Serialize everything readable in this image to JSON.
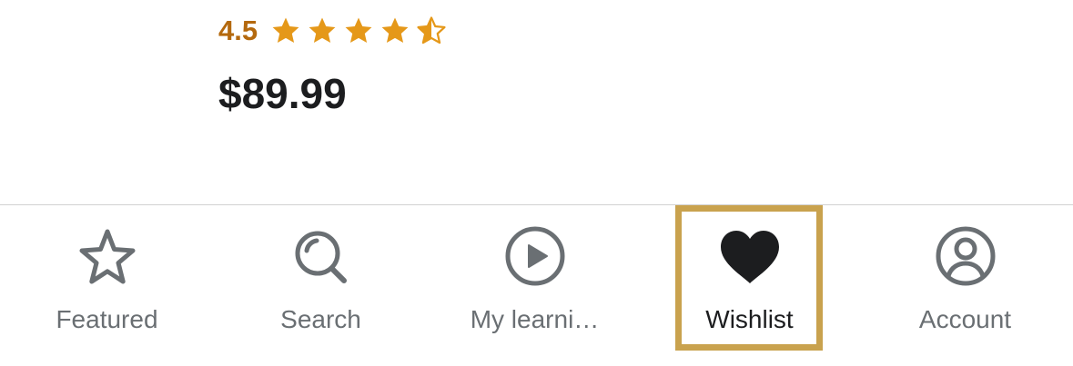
{
  "course": {
    "rating": "4.5",
    "rating_stars": 4.5,
    "price": "$89.99"
  },
  "colors": {
    "rating_text": "#b4690e",
    "star_fill": "#e59819",
    "price_text": "#1c1d1f",
    "tab_inactive": "#6a6f73",
    "tab_active": "#1c1d1f",
    "highlight_border": "#c9a24e",
    "divider": "#d1d1d1"
  },
  "tab_bar": {
    "tabs": [
      {
        "label": "Featured",
        "icon": "star-outline-icon",
        "active": false
      },
      {
        "label": "Search",
        "icon": "search-icon",
        "active": false
      },
      {
        "label": "My learni…",
        "icon": "play-circle-icon",
        "active": false
      },
      {
        "label": "Wishlist",
        "icon": "heart-filled-icon",
        "active": true
      },
      {
        "label": "Account",
        "icon": "account-circle-icon",
        "active": false
      }
    ]
  }
}
